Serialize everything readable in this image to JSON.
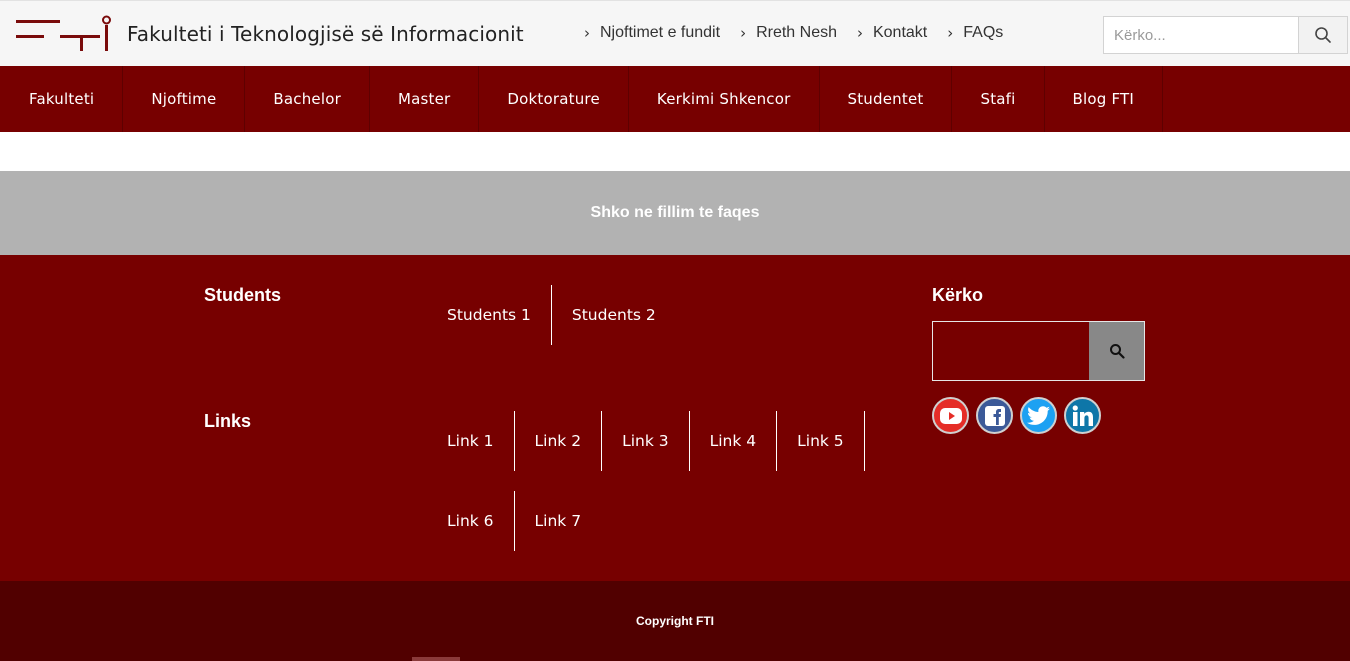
{
  "header": {
    "site_name": "Fakulteti i Teknologjisë së Informacionit",
    "top_links": [
      {
        "label": "Njoftimet e fundit"
      },
      {
        "label": "Rreth Nesh"
      },
      {
        "label": "Kontakt"
      },
      {
        "label": "FAQs"
      }
    ],
    "search": {
      "placeholder": "Kërko..."
    }
  },
  "nav": {
    "items": [
      "Fakulteti",
      "Njoftime",
      "Bachelor",
      "Master",
      "Doktorature",
      "Kerkimi Shkencor",
      "Studentet",
      "Stafi",
      "Blog FTI"
    ]
  },
  "back_to_top": {
    "label": "Shko ne fillim te faqes"
  },
  "footer": {
    "students": {
      "heading": "Students",
      "links": [
        "Students 1",
        "Students 2"
      ]
    },
    "links": {
      "heading": "Links",
      "row1": [
        "Link 1",
        "Link 2",
        "Link 3",
        "Link 4",
        "Link 5"
      ],
      "row2": [
        "Link 6",
        "Link 7"
      ]
    },
    "search": {
      "heading": "Kërko"
    },
    "socials": [
      {
        "name": "youtube-icon",
        "color": "#e52d27"
      },
      {
        "name": "facebook-icon",
        "color": "#3b5998"
      },
      {
        "name": "twitter-icon",
        "color": "#1da1f2"
      },
      {
        "name": "linkedin-icon",
        "color": "#0e76a8"
      }
    ]
  },
  "copyright": {
    "text": "Copyright FTI"
  },
  "colors": {
    "brand": "#770000",
    "footer_dark": "#510000",
    "back_to_top": "#b2b2b2"
  }
}
